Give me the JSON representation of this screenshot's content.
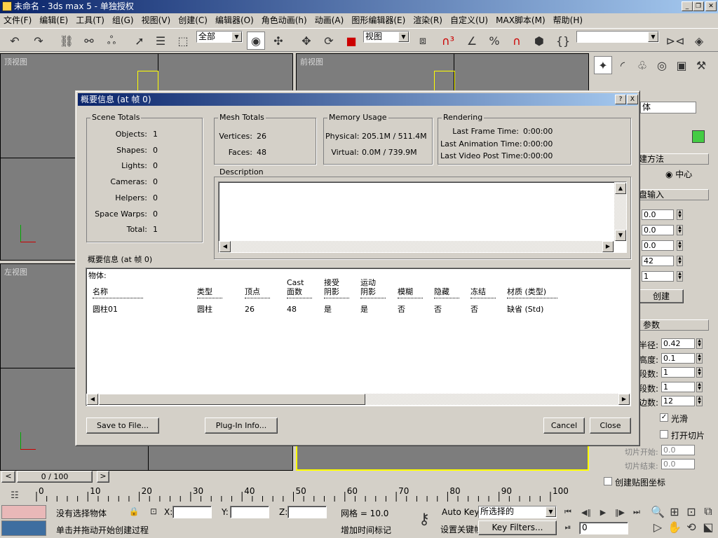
{
  "app": {
    "title": "未命名 - 3ds max 5 - 单独授权"
  },
  "menu": [
    "文件(F)",
    "编辑(E)",
    "工具(T)",
    "组(G)",
    "视图(V)",
    "创建(C)",
    "编辑器(O)",
    "角色动画(h)",
    "动画(A)",
    "图形编辑器(E)",
    "渲染(R)",
    "自定义(U)",
    "MAX脚本(M)",
    "帮助(H)"
  ],
  "toolbar": {
    "selection_filter": "全部",
    "reference_coord": "视图",
    "named_sel": ""
  },
  "viewports": {
    "top": "顶视图",
    "front": "前视图",
    "left": "左视图"
  },
  "dialog": {
    "title": "概要信息 (at 帧 0)",
    "help": "?",
    "close": "X",
    "scene_totals": {
      "label": "Scene Totals",
      "rows": [
        {
          "k": "Objects:",
          "v": "1"
        },
        {
          "k": "Shapes:",
          "v": "0"
        },
        {
          "k": "Lights:",
          "v": "0"
        },
        {
          "k": "Cameras:",
          "v": "0"
        },
        {
          "k": "Helpers:",
          "v": "0"
        },
        {
          "k": "Space Warps:",
          "v": "0"
        },
        {
          "k": "Total:",
          "v": "1"
        }
      ]
    },
    "mesh_totals": {
      "label": "Mesh Totals",
      "rows": [
        {
          "k": "Vertices:",
          "v": "26"
        },
        {
          "k": "Faces:",
          "v": "48"
        }
      ]
    },
    "memory": {
      "label": "Memory Usage",
      "rows": [
        {
          "k": "Physical:",
          "v": "205.1M / 511.4M"
        },
        {
          "k": "Virtual:",
          "v": "0.0M / 739.9M"
        }
      ]
    },
    "rendering": {
      "label": "Rendering",
      "rows": [
        {
          "k": "Last Frame Time:",
          "v": "0:00:00"
        },
        {
          "k": "Last Animation Time:",
          "v": "0:00:00"
        },
        {
          "k": "Last Video Post Time:",
          "v": "0:00:00"
        }
      ]
    },
    "description": {
      "label": "Description"
    },
    "summary_label": "概要信息 (at 帧 0)",
    "objects_label": "物体:",
    "columns": [
      {
        "h1": "",
        "h2": "名称",
        "v": "圆柱01"
      },
      {
        "h1": "",
        "h2": "类型",
        "v": "圆柱"
      },
      {
        "h1": "",
        "h2": "顶点",
        "v": "26"
      },
      {
        "h1": "Cast",
        "h2": "面数",
        "v": "48"
      },
      {
        "h1": "接受",
        "h2": "阴影",
        "v": "是"
      },
      {
        "h1": "运动",
        "h2": "阴影",
        "v": "是"
      },
      {
        "h1": "",
        "h2": "模糊",
        "v": "否"
      },
      {
        "h1": "",
        "h2": "隐藏",
        "v": "否"
      },
      {
        "h1": "",
        "h2": "冻结",
        "v": "否"
      },
      {
        "h1": "",
        "h2": "材质 (类型)",
        "v": "缺省 (Std)"
      }
    ],
    "buttons": {
      "save": "Save to File...",
      "plugin": "Plug-In Info...",
      "cancel": "Cancel",
      "close": "Close"
    }
  },
  "cmd": {
    "combo": "体",
    "sect_method": "建方法",
    "center": "中心",
    "sect_kbd": "盘输入",
    "create": "创建",
    "sect_params": "参数",
    "kbd_vals": [
      "0.0",
      "0.0",
      "0.0",
      "42",
      "1"
    ],
    "params": [
      {
        "k": "半径:",
        "v": "0.42"
      },
      {
        "k": "高度:",
        "v": "0.1"
      },
      {
        "k": "段数:",
        "v": "1"
      },
      {
        "k": "段数:",
        "v": "1"
      },
      {
        "k": "边数:",
        "v": "12"
      }
    ],
    "smooth": "光滑",
    "slice_on": "打开切片",
    "slice_from": "切片开始:",
    "slice_to": "切片结束:",
    "slice_from_v": "0.0",
    "slice_to_v": "0.0",
    "gen_map": "创建贴图坐标"
  },
  "time": {
    "slider": "0 / 100",
    "ticks": [
      "0",
      "10",
      "20",
      "30",
      "40",
      "50",
      "60",
      "70",
      "80",
      "90",
      "100"
    ]
  },
  "status": {
    "sel": "没有选择物体",
    "x": "X:",
    "y": "Y:",
    "z": "Z:",
    "grid": "网格 = 10.0",
    "autokey": "Auto Key",
    "selected": "所选择的",
    "setkey": "设置关键帧",
    "keyfilters": "Key Filters...",
    "prompt": "单击并拖动开始创建过程",
    "addtime": "增加时间标记",
    "frame": "0"
  }
}
